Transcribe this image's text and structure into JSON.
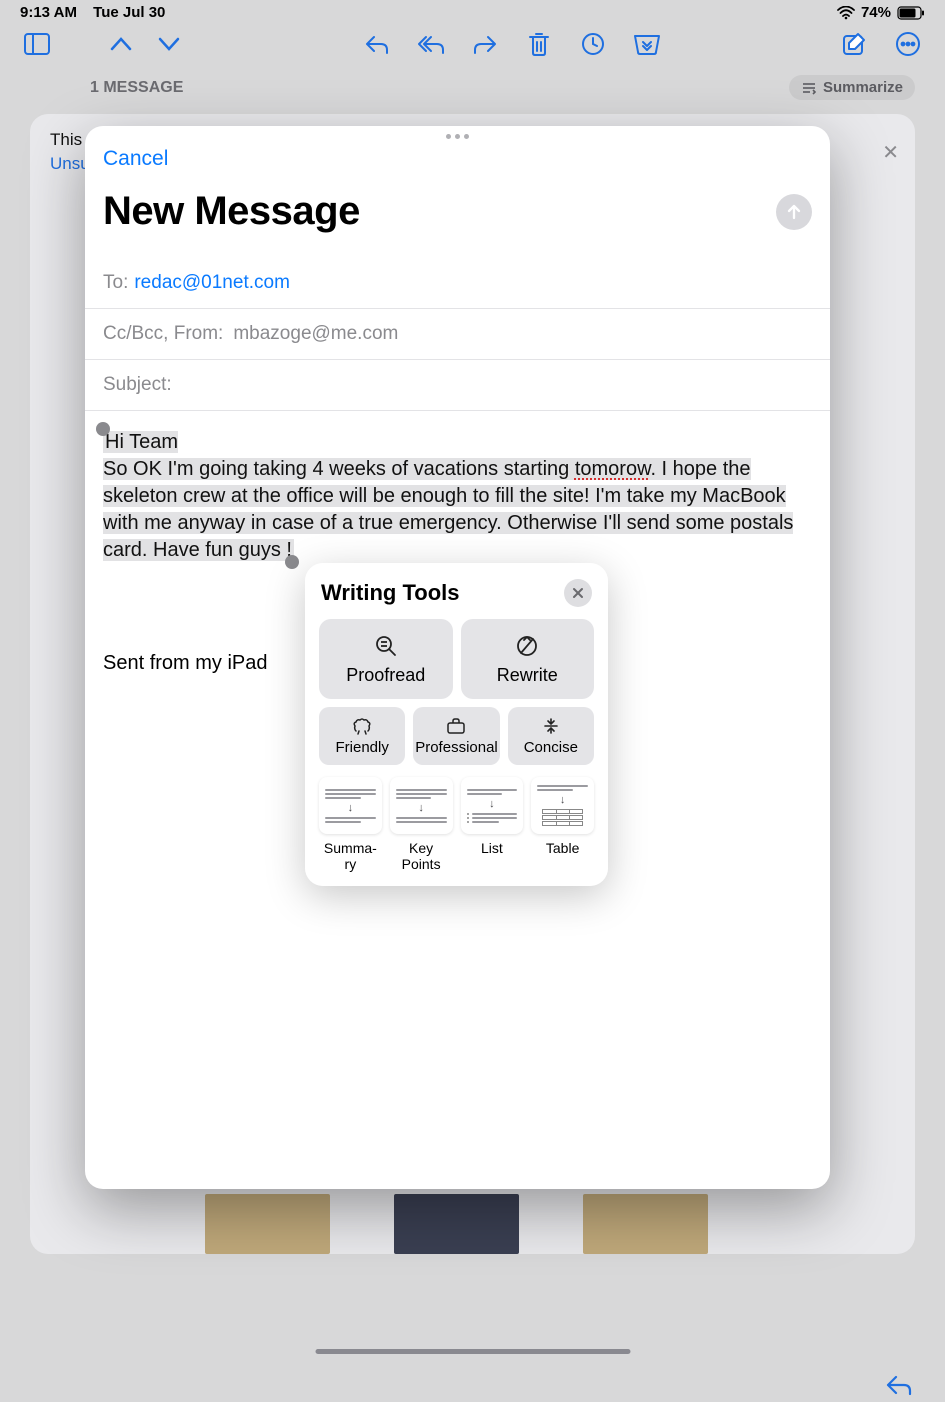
{
  "status": {
    "time": "9:13 AM",
    "date": "Tue Jul 30",
    "battery_pct": "74%"
  },
  "header": {
    "message_count": "1 MESSAGE",
    "summarize_label": "Summarize"
  },
  "bg_message": {
    "snippet": "This n",
    "unsubscribe": "Unsub"
  },
  "compose": {
    "cancel": "Cancel",
    "title": "New Message",
    "to_label": "To:",
    "to_value": "redac@01net.com",
    "cc_label": "Cc/Bcc, From:",
    "from_value": "mbazoge@me.com",
    "subject_label": "Subject:",
    "body_greeting": "Hi Team",
    "body_p1": "So OK I'm going taking 4 weeks of vacations starting ",
    "body_misspelled": "tomorow",
    "body_p2_after": ". I hope the skeleton crew at the office will be enough to fill the site! I'm take my MacBook with me anyway in case of a true emergency. Otherwise I'll send some postals card. Have fun guys !",
    "signature": "Sent from my iPad"
  },
  "writing_tools": {
    "title": "Writing Tools",
    "proofread": "Proofread",
    "rewrite": "Rewrite",
    "friendly": "Friendly",
    "professional": "Professional",
    "concise": "Concise",
    "summary": "Summa-\nry",
    "keypoints": "Key\nPoints",
    "list": "List",
    "table": "Table"
  }
}
